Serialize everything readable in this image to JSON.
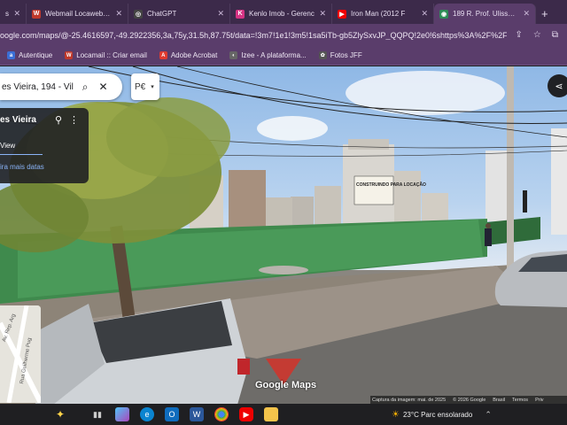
{
  "tabs": [
    {
      "label": "s",
      "favicon": "#6e5a7e",
      "icon": "tab-icon"
    },
    {
      "label": "Webmail Locaweb :: L",
      "favicon": "#c0392b",
      "icon": "webmail-icon",
      "fav_text": "W"
    },
    {
      "label": "ChatGPT",
      "favicon": "#444",
      "icon": "chatgpt-icon",
      "fav_text": "◎"
    },
    {
      "label": "Kenlo Imob - Gerenc",
      "favicon": "#d63384",
      "icon": "kenlo-icon",
      "fav_text": "K"
    },
    {
      "label": "Iron Man (2012 F",
      "favicon": "#e00",
      "icon": "youtube-icon",
      "fav_text": "▶"
    },
    {
      "label": "189 R. Prof. Ulisses V",
      "favicon": "#2e8b57",
      "icon": "maps-icon",
      "fav_text": "◉",
      "active": true
    }
  ],
  "address": {
    "url": "oogle.com/maps/@-25.4616597,-49.2922356,3a,75y,31.5h,87.75t/data=!3m7!1e1!3m5!1sa5iTb-gb5ZlySxvJP_QQPQ!2e0!6shttps%3A%2F%2Fstreetview..."
  },
  "bookmarks": [
    {
      "label": "Autentique",
      "color": "#3b6fd6",
      "icon": "autentique-icon",
      "fav_text": "a"
    },
    {
      "label": "Locamail :: Criar email",
      "color": "#c0392b",
      "icon": "locamail-icon",
      "fav_text": "W"
    },
    {
      "label": "Adobe Acrobat",
      "color": "#e03a2f",
      "icon": "acrobat-icon",
      "fav_text": "A"
    },
    {
      "label": "Izee - A plataforma...",
      "color": "#666",
      "icon": "izee-icon",
      "fav_text": "◐"
    },
    {
      "label": "Fotos JFF",
      "color": "#555",
      "icon": "photos-icon",
      "fav_text": "✿"
    }
  ],
  "maps": {
    "search_value": "es Vieira, 194 - Vil",
    "pano_label": "P€",
    "card_title": "es Vieira",
    "card_view": "View",
    "card_more_dates": "ira mais datas",
    "minimap_street_1": "Av. Rep. Arg",
    "minimap_street_2": "Rua Guilherme Pug",
    "logo": "Google Maps",
    "attribution": [
      "Captura da imagem: mai. de 2025",
      "© 2026 Google",
      "Brasil",
      "Termos",
      "Priv"
    ],
    "sign_text": "CONSTRUINDO PARA LOCAÇÃO"
  },
  "taskbar": {
    "weather": "23°C  Parc ensolarado"
  }
}
